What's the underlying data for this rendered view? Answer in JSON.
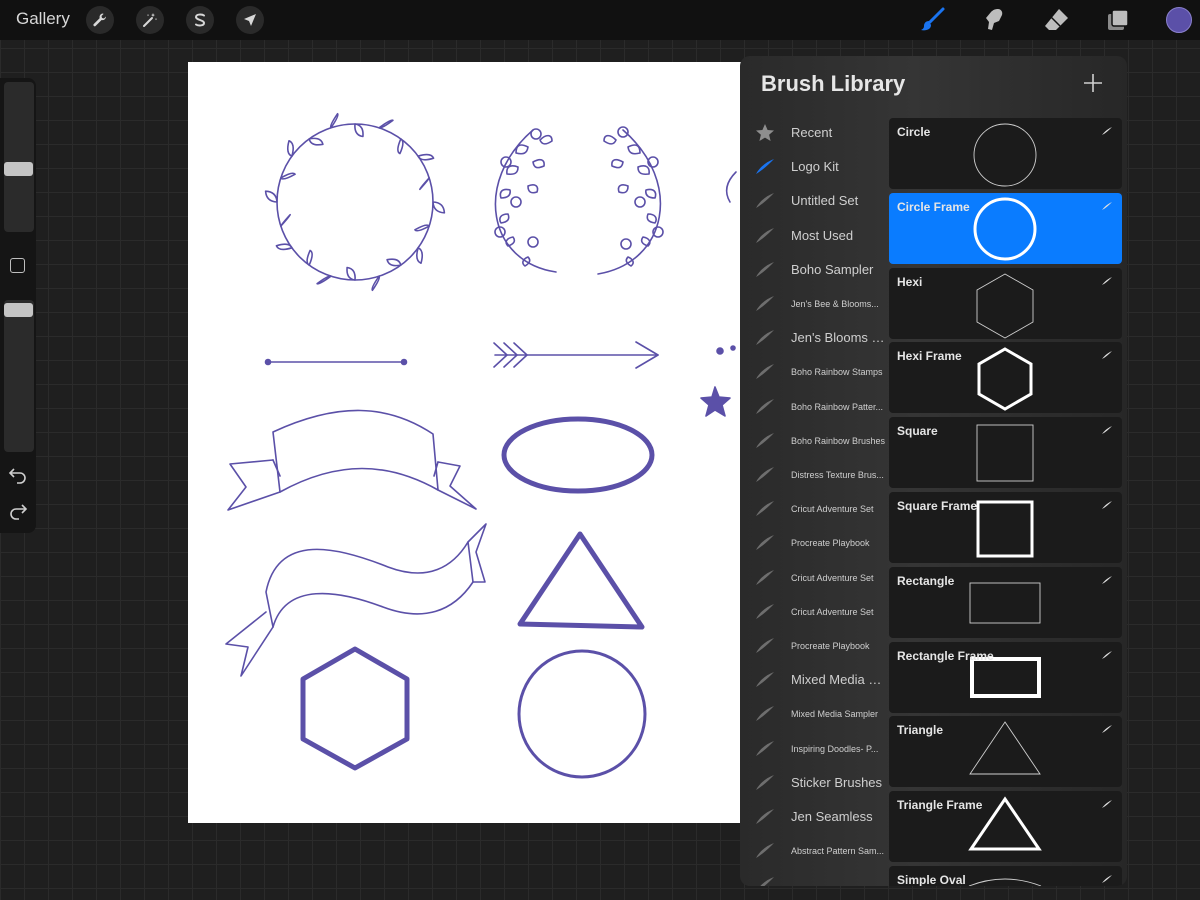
{
  "topbar": {
    "gallery_label": "Gallery",
    "left_tools": [
      "wrench-icon",
      "magic-wand-icon",
      "selection-s-icon",
      "arrow-transform-icon"
    ],
    "right_tools": [
      "brush-icon",
      "smudge-icon",
      "eraser-icon",
      "layers-icon"
    ],
    "active_tool": "brush-icon",
    "current_color": "#5b50a8"
  },
  "sidebar": {
    "size_slider_value": 0.2,
    "opacity_slider_value": 0.05,
    "controls": [
      "modify-button",
      "undo-icon",
      "redo-icon"
    ]
  },
  "canvas": {
    "stroke_color": "#5b50a8",
    "background": "#ffffff"
  },
  "brush_library": {
    "title": "Brush Library",
    "accent": "#0a7cff",
    "sets": [
      {
        "label": "Recent",
        "icon": "star-icon",
        "small": false
      },
      {
        "label": "Logo Kit",
        "icon": "brush-stroke-icon",
        "small": false,
        "selected": true
      },
      {
        "label": "Untitled Set",
        "icon": "brush-stroke-icon",
        "small": false
      },
      {
        "label": "Most Used",
        "icon": "brush-stroke-icon",
        "small": false
      },
      {
        "label": "Boho Sampler",
        "icon": "brush-stroke-icon",
        "small": false
      },
      {
        "label": "Jen's Bee & Blooms...",
        "icon": "brush-stroke-icon",
        "small": true
      },
      {
        "label": "Jen's Blooms Set",
        "icon": "brush-stroke-icon",
        "small": false
      },
      {
        "label": "Boho Rainbow Stamps",
        "icon": "brush-stroke-icon",
        "small": true
      },
      {
        "label": "Boho Rainbow Patter...",
        "icon": "brush-stroke-icon",
        "small": true
      },
      {
        "label": "Boho Rainbow Brushes",
        "icon": "brush-stroke-icon",
        "small": true
      },
      {
        "label": "Distress Texture Brus...",
        "icon": "brush-stroke-icon",
        "small": true
      },
      {
        "label": "Cricut Adventure Set",
        "icon": "brush-stroke-icon",
        "small": true
      },
      {
        "label": "Procreate Playbook",
        "icon": "brush-stroke-icon",
        "small": true
      },
      {
        "label": "Cricut Adventure Set",
        "icon": "brush-stroke-icon",
        "small": true
      },
      {
        "label": "Cricut Adventure Set",
        "icon": "brush-stroke-icon",
        "small": true
      },
      {
        "label": "Procreate Playbook",
        "icon": "brush-stroke-icon",
        "small": true
      },
      {
        "label": "Mixed Media Set",
        "icon": "brush-stroke-icon",
        "small": false
      },
      {
        "label": "Mixed Media Sampler",
        "icon": "brush-stroke-icon",
        "small": true
      },
      {
        "label": "Inspiring Doodles- P...",
        "icon": "brush-stroke-icon",
        "small": true
      },
      {
        "label": "Sticker Brushes",
        "icon": "brush-stroke-icon",
        "small": false
      },
      {
        "label": "Jen Seamless",
        "icon": "brush-stroke-icon",
        "small": false
      },
      {
        "label": "Abstract Pattern Sam...",
        "icon": "brush-stroke-icon",
        "small": true
      },
      {
        "label": "",
        "icon": "brush-stroke-icon",
        "small": true
      }
    ],
    "brushes": [
      {
        "name": "Circle",
        "shape": "circle"
      },
      {
        "name": "Circle Frame",
        "shape": "circle-frame",
        "selected": true
      },
      {
        "name": "Hexi",
        "shape": "hexagon"
      },
      {
        "name": "Hexi Frame",
        "shape": "hexagon-frame"
      },
      {
        "name": "Square",
        "shape": "square"
      },
      {
        "name": "Square Frame",
        "shape": "square-frame"
      },
      {
        "name": "Rectangle",
        "shape": "rectangle"
      },
      {
        "name": "Rectangle Frame",
        "shape": "rectangle-frame"
      },
      {
        "name": "Triangle",
        "shape": "triangle"
      },
      {
        "name": "Triangle Frame",
        "shape": "triangle-frame"
      },
      {
        "name": "Simple Oval",
        "shape": "oval"
      }
    ]
  }
}
